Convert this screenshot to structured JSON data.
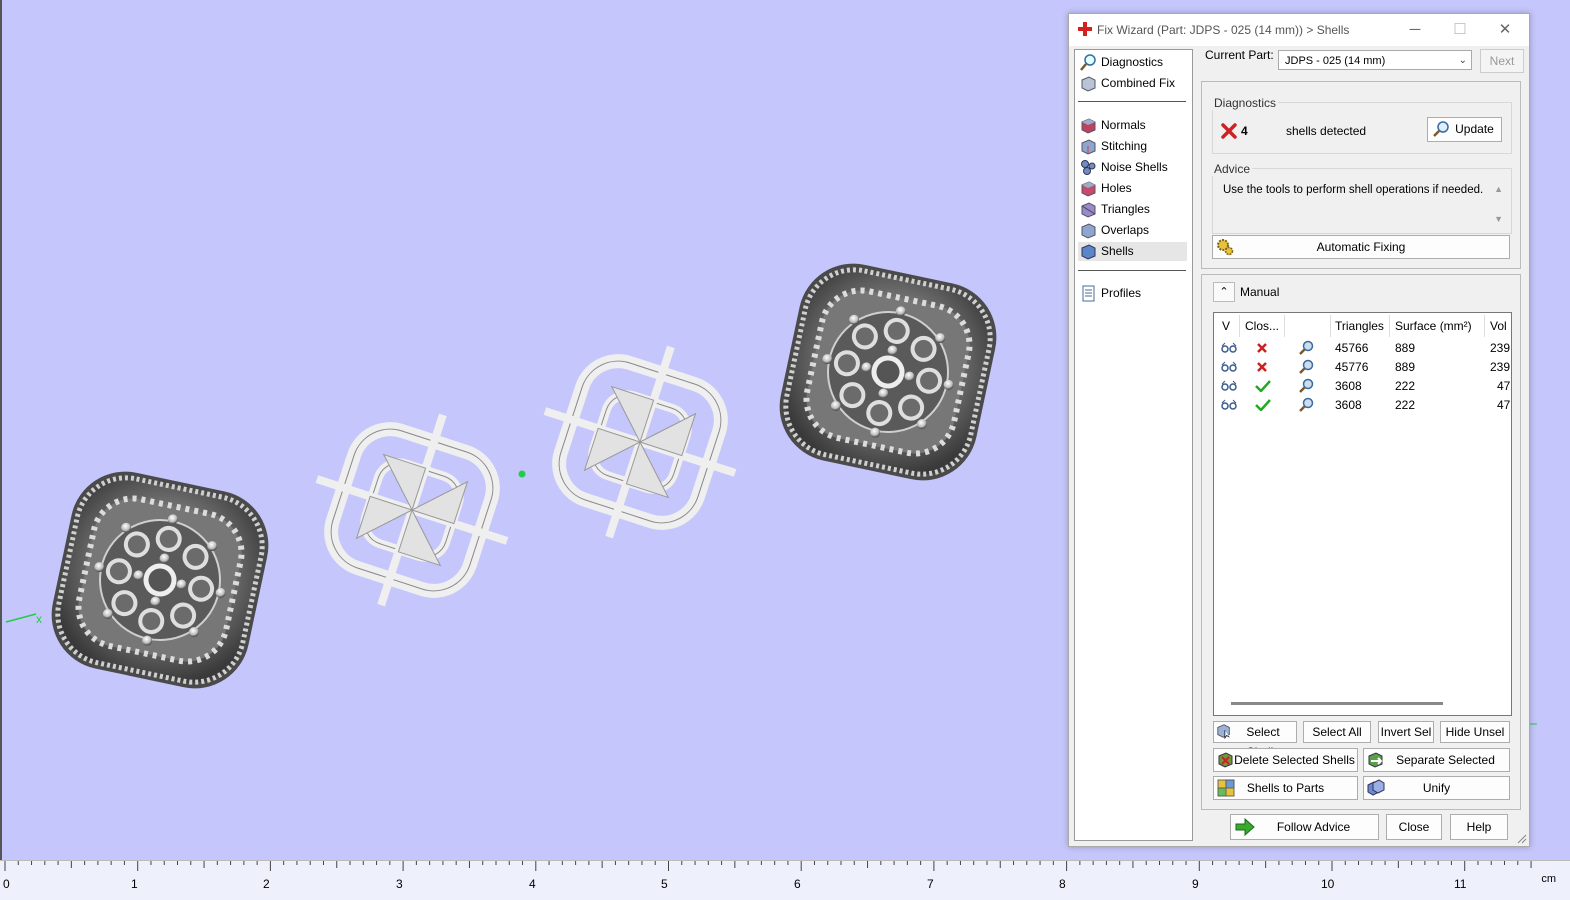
{
  "window": {
    "title": "Fix Wizard (Part: JDPS - 025 (14 mm)) > Shells",
    "minimize": "─",
    "maximize": "☐",
    "close": "✕"
  },
  "nav": {
    "items": [
      {
        "label": "Diagnostics"
      },
      {
        "label": "Combined Fix"
      },
      {
        "label": "Normals"
      },
      {
        "label": "Stitching"
      },
      {
        "label": "Noise Shells"
      },
      {
        "label": "Holes"
      },
      {
        "label": "Triangles"
      },
      {
        "label": "Overlaps"
      },
      {
        "label": "Shells"
      },
      {
        "label": "Profiles"
      }
    ]
  },
  "current_part": {
    "label": "Current Part:",
    "value": "JDPS - 025 (14 mm)",
    "next_label": "Next"
  },
  "diagnostics": {
    "group_title": "Diagnostics",
    "count": "4",
    "status_text": "shells detected",
    "update_label": "Update"
  },
  "advice": {
    "group_title": "Advice",
    "text": "Use the tools to perform shell operations if needed.",
    "auto_fix_label": "Automatic Fixing"
  },
  "manual": {
    "label": "Manual",
    "columns": [
      "V",
      "Clos...",
      "Triangles",
      "Surface (mm²)",
      "Vol"
    ],
    "rows": [
      {
        "closed": false,
        "triangles": "45766",
        "surface": "889",
        "volume": "239"
      },
      {
        "closed": false,
        "triangles": "45776",
        "surface": "889",
        "volume": "239"
      },
      {
        "closed": true,
        "triangles": "3608",
        "surface": "222",
        "volume": "47"
      },
      {
        "closed": true,
        "triangles": "3608",
        "surface": "222",
        "volume": "47"
      }
    ],
    "buttons": {
      "select_shells": "Select Shells",
      "select_all": "Select All",
      "invert_sel": "Invert Sel",
      "hide_unsel": "Hide Unsel",
      "delete_selected": "Delete Selected Shells",
      "separate_selected": "Separate Selected Shells",
      "shells_to_parts": "Shells to Parts",
      "unify": "Unify"
    }
  },
  "footer": {
    "follow_advice": "Follow Advice",
    "close": "Close",
    "help": "Help"
  },
  "ruler": {
    "labels": [
      "0",
      "1",
      "2",
      "3",
      "4",
      "5",
      "6",
      "7",
      "8",
      "9",
      "10",
      "11"
    ],
    "unit": "cm"
  },
  "axis_label": "x",
  "colors": {
    "viewport_bg": "#c5c6fb",
    "error_red": "#cc2222",
    "ok_green": "#22aa22",
    "axis_green": "#22cc44"
  }
}
